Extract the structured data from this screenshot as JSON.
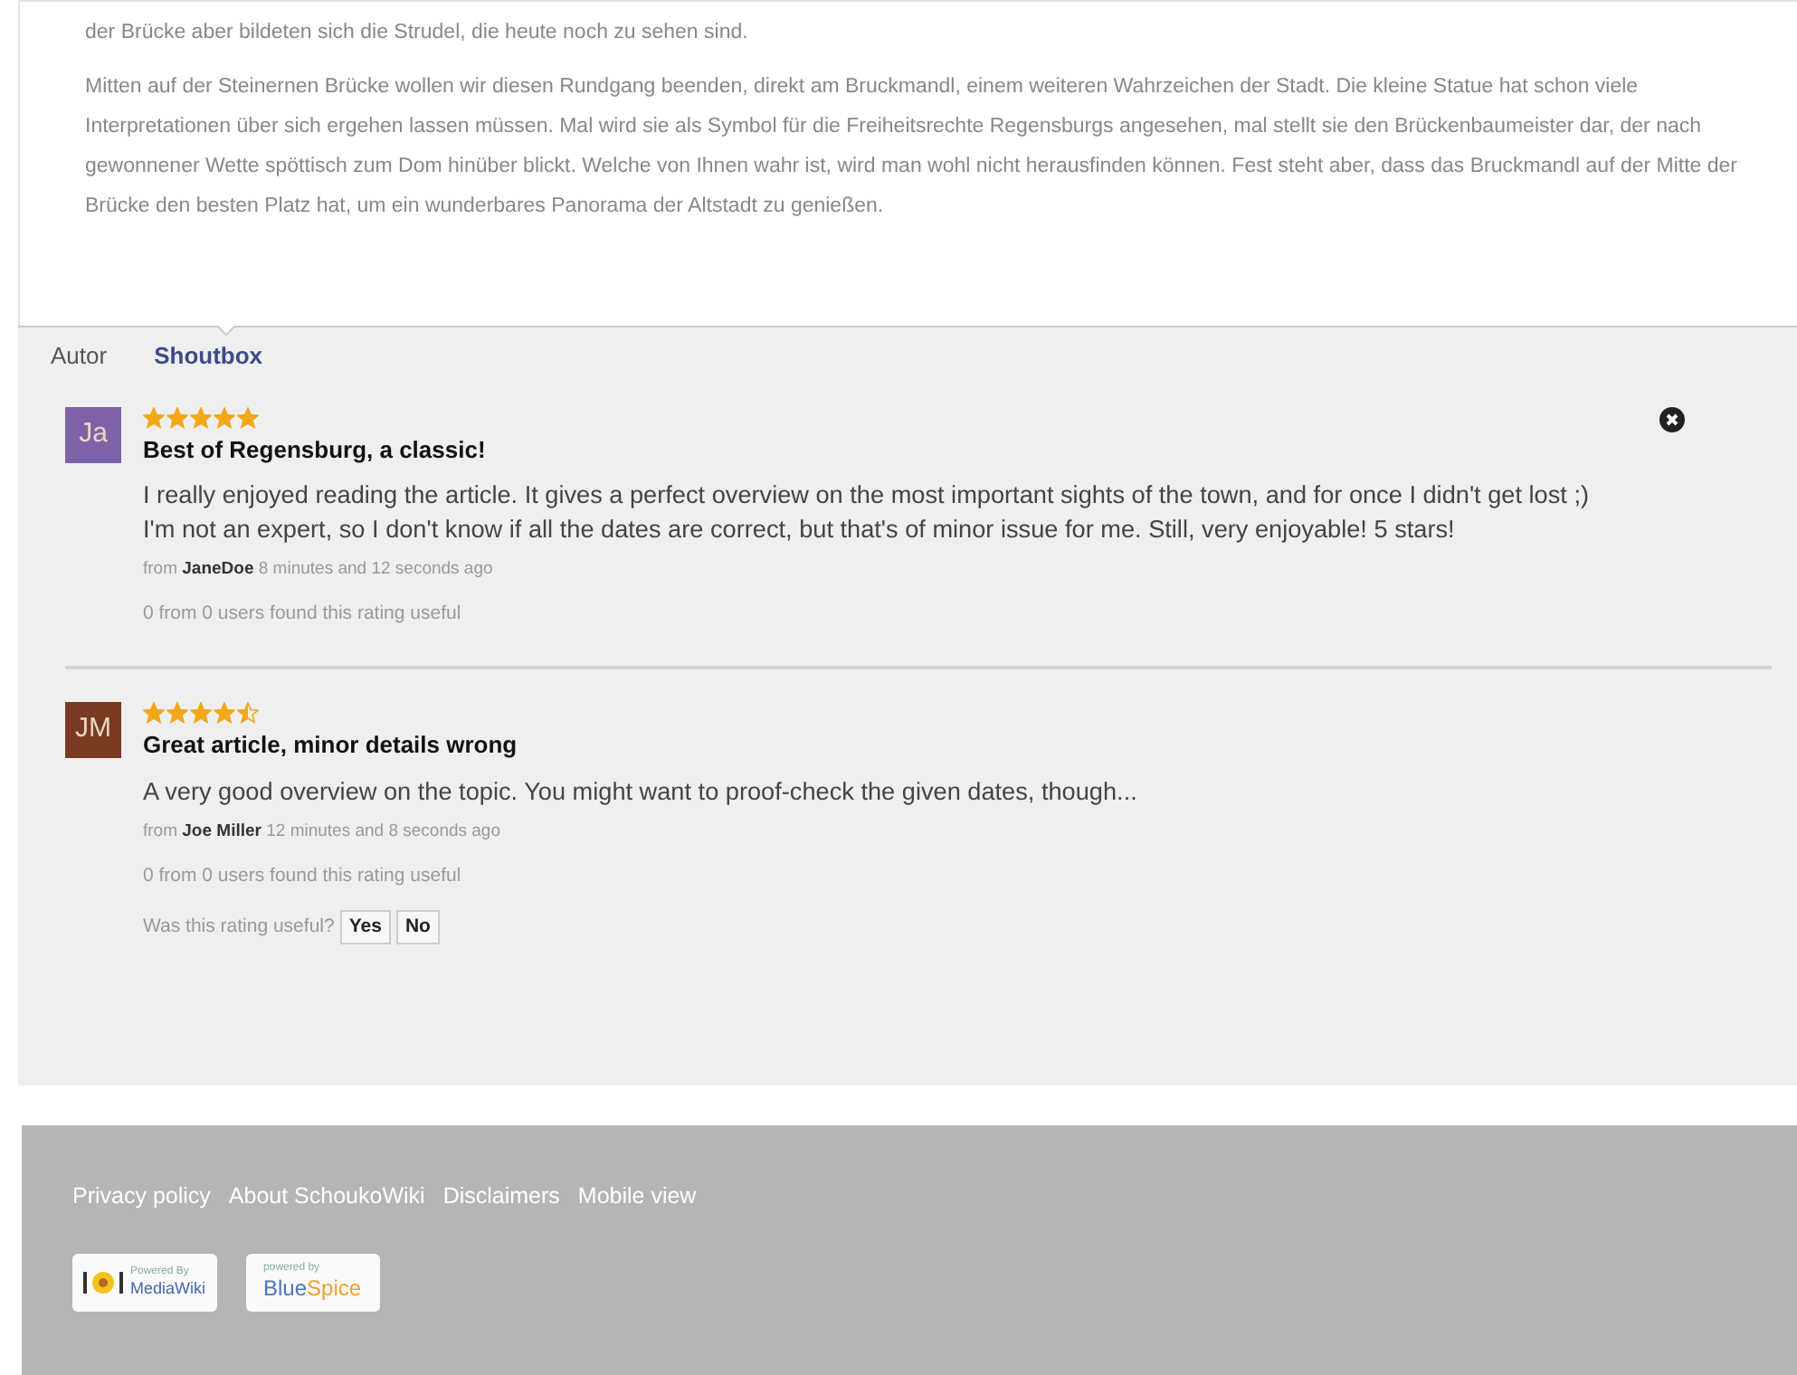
{
  "article": {
    "paragraphs": [
      "der Brücke aber bildeten sich die Strudel, die heute noch zu sehen sind.",
      "Mitten auf der Steinernen Brücke wollen wir diesen Rundgang beenden, direkt am Bruckmandl, einem weiteren Wahrzeichen der Stadt. Die kleine Statue hat schon viele Interpretationen über sich ergehen lassen müssen. Mal wird sie als Symbol für die Freiheitsrechte Regensburgs angesehen, mal stellt sie den Brückenbaumeister dar, der nach gewonnener Wette spöttisch zum Dom hinüber blickt. Welche von Ihnen wahr ist, wird man wohl nicht herausfinden können. Fest steht aber, dass das Bruckmandl auf der Mitte der Brücke den besten Platz hat, um ein wunderbares Panorama der Altstadt zu genießen."
    ]
  },
  "tabs": [
    {
      "label": "Autor",
      "selected": false
    },
    {
      "label": "Shoutbox",
      "selected": true
    }
  ],
  "ratings": [
    {
      "initials": "Ja",
      "color": "#7e62a8",
      "stars": 5,
      "title": "Best of Regensburg, a classic!",
      "text": [
        "I really enjoyed reading the article. It gives a perfect overview on the most important sights of the town, and for once I didn't get lost ;)",
        "I'm not an expert, so I don't know if all the dates are correct, but that's of minor issue for me. Still, very enjoyable! 5 stars!"
      ],
      "byline": "from **JaneDoe** 8 minutes and 12 seconds ago",
      "useful": "0 from 0 users found this rating useful",
      "deletable": true
    },
    {
      "initials": "JM",
      "color": "#7a3a22",
      "stars": 4.5,
      "title": "Great article, minor details wrong",
      "text": [
        "A very good overview on the topic. You might want to proof-check the given dates, though..."
      ],
      "byline": "from **Joe Miller** 12 minutes and 8 seconds ago",
      "useful": "0 from 0 users found this rating useful",
      "deletable": false,
      "vote": {
        "prompt": "Was this rating useful?",
        "buttons": [
          "Yes",
          "No"
        ]
      }
    }
  ],
  "footer": {
    "links": [
      {
        "label": "Privacy policy"
      },
      {
        "label": "About SchoukoWiki"
      },
      {
        "label": "Disclaimers"
      },
      {
        "label": "Mobile view"
      }
    ],
    "badges": [
      {
        "kind": "mediawiki",
        "small": "Powered By",
        "name": "MediaWiki"
      },
      {
        "kind": "bluespice",
        "small": "powered by",
        "word_1": "Blue",
        "word_2": "Spice"
      }
    ]
  }
}
